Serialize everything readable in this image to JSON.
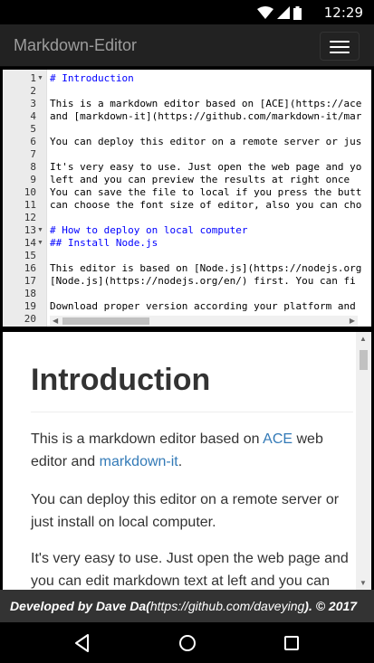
{
  "status_bar": {
    "time": "12:29",
    "icons": [
      "wifi-icon",
      "signal-icon",
      "battery-icon"
    ]
  },
  "navbar": {
    "brand": "Markdown-Editor",
    "menu_icon": "hamburger-menu-icon"
  },
  "editor": {
    "line_numbers": [
      "1",
      "2",
      "3",
      "4",
      "5",
      "6",
      "7",
      "8",
      "9",
      "10",
      "11",
      "12",
      "13",
      "14",
      "15",
      "16",
      "17",
      "18",
      "19",
      "20"
    ],
    "folded_lines": [
      "1",
      "13",
      "14"
    ],
    "lines": [
      "# Introduction",
      "",
      "This is a markdown editor based on [ACE](https://ace",
      "and [markdown-it](https://github.com/markdown-it/mar",
      "",
      "You can deploy this editor on a remote server or jus",
      "",
      "It's very easy to use. Just open the web page and yo",
      "left and you can preview the results at right once",
      "You can save the file to local if you press the butt",
      "can choose the font size of editor, also you can cho",
      "",
      "# How to deploy on local computer",
      "## Install Node.js",
      "",
      "This editor is based on [Node.js](https://nodejs.org",
      "[Node.js](https://nodejs.org/en/) first. You can fi",
      "",
      "Download proper version according your platform and",
      ""
    ]
  },
  "preview": {
    "title": "Introduction",
    "p1_before": "This is a markdown editor based on ",
    "p1_link1": "ACE",
    "p1_middle": " web editor and ",
    "p1_link2": "markdown-it",
    "p1_after": ".",
    "p2": "You can deploy this editor on a remote server or just install on local computer.",
    "p3": "It's very easy to use. Just open the web page and you can edit markdown text at left and you can"
  },
  "footer": {
    "prefix": "Developed by Dave Da(",
    "link": "https://github.com/daveying",
    "suffix": "). © 2017"
  },
  "android_nav": {
    "back": "back-icon",
    "home": "home-icon",
    "recents": "recents-icon"
  }
}
